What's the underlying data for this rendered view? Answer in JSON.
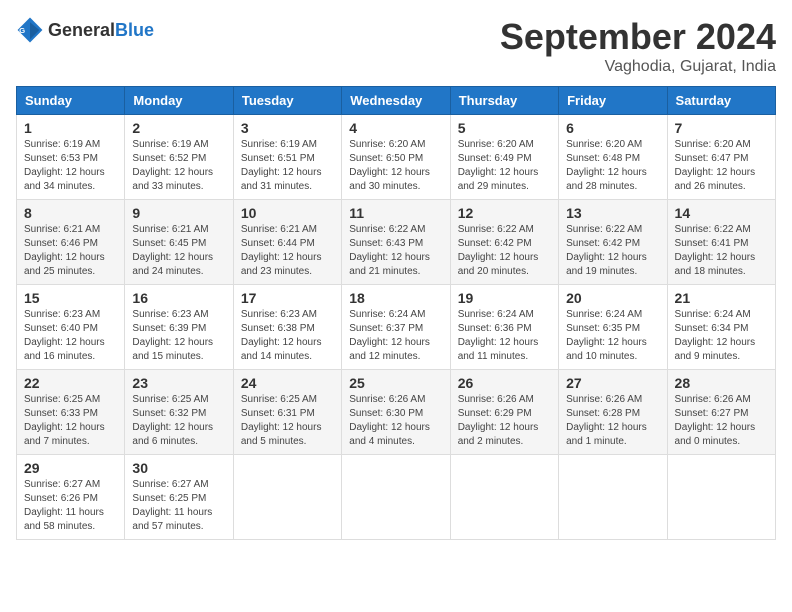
{
  "logo": {
    "general": "General",
    "blue": "Blue"
  },
  "title": "September 2024",
  "location": "Vaghodia, Gujarat, India",
  "headers": [
    "Sunday",
    "Monday",
    "Tuesday",
    "Wednesday",
    "Thursday",
    "Friday",
    "Saturday"
  ],
  "weeks": [
    [
      {
        "day": "1",
        "info": "Sunrise: 6:19 AM\nSunset: 6:53 PM\nDaylight: 12 hours\nand 34 minutes."
      },
      {
        "day": "2",
        "info": "Sunrise: 6:19 AM\nSunset: 6:52 PM\nDaylight: 12 hours\nand 33 minutes."
      },
      {
        "day": "3",
        "info": "Sunrise: 6:19 AM\nSunset: 6:51 PM\nDaylight: 12 hours\nand 31 minutes."
      },
      {
        "day": "4",
        "info": "Sunrise: 6:20 AM\nSunset: 6:50 PM\nDaylight: 12 hours\nand 30 minutes."
      },
      {
        "day": "5",
        "info": "Sunrise: 6:20 AM\nSunset: 6:49 PM\nDaylight: 12 hours\nand 29 minutes."
      },
      {
        "day": "6",
        "info": "Sunrise: 6:20 AM\nSunset: 6:48 PM\nDaylight: 12 hours\nand 28 minutes."
      },
      {
        "day": "7",
        "info": "Sunrise: 6:20 AM\nSunset: 6:47 PM\nDaylight: 12 hours\nand 26 minutes."
      }
    ],
    [
      {
        "day": "8",
        "info": "Sunrise: 6:21 AM\nSunset: 6:46 PM\nDaylight: 12 hours\nand 25 minutes."
      },
      {
        "day": "9",
        "info": "Sunrise: 6:21 AM\nSunset: 6:45 PM\nDaylight: 12 hours\nand 24 minutes."
      },
      {
        "day": "10",
        "info": "Sunrise: 6:21 AM\nSunset: 6:44 PM\nDaylight: 12 hours\nand 23 minutes."
      },
      {
        "day": "11",
        "info": "Sunrise: 6:22 AM\nSunset: 6:43 PM\nDaylight: 12 hours\nand 21 minutes."
      },
      {
        "day": "12",
        "info": "Sunrise: 6:22 AM\nSunset: 6:42 PM\nDaylight: 12 hours\nand 20 minutes."
      },
      {
        "day": "13",
        "info": "Sunrise: 6:22 AM\nSunset: 6:42 PM\nDaylight: 12 hours\nand 19 minutes."
      },
      {
        "day": "14",
        "info": "Sunrise: 6:22 AM\nSunset: 6:41 PM\nDaylight: 12 hours\nand 18 minutes."
      }
    ],
    [
      {
        "day": "15",
        "info": "Sunrise: 6:23 AM\nSunset: 6:40 PM\nDaylight: 12 hours\nand 16 minutes."
      },
      {
        "day": "16",
        "info": "Sunrise: 6:23 AM\nSunset: 6:39 PM\nDaylight: 12 hours\nand 15 minutes."
      },
      {
        "day": "17",
        "info": "Sunrise: 6:23 AM\nSunset: 6:38 PM\nDaylight: 12 hours\nand 14 minutes."
      },
      {
        "day": "18",
        "info": "Sunrise: 6:24 AM\nSunset: 6:37 PM\nDaylight: 12 hours\nand 12 minutes."
      },
      {
        "day": "19",
        "info": "Sunrise: 6:24 AM\nSunset: 6:36 PM\nDaylight: 12 hours\nand 11 minutes."
      },
      {
        "day": "20",
        "info": "Sunrise: 6:24 AM\nSunset: 6:35 PM\nDaylight: 12 hours\nand 10 minutes."
      },
      {
        "day": "21",
        "info": "Sunrise: 6:24 AM\nSunset: 6:34 PM\nDaylight: 12 hours\nand 9 minutes."
      }
    ],
    [
      {
        "day": "22",
        "info": "Sunrise: 6:25 AM\nSunset: 6:33 PM\nDaylight: 12 hours\nand 7 minutes."
      },
      {
        "day": "23",
        "info": "Sunrise: 6:25 AM\nSunset: 6:32 PM\nDaylight: 12 hours\nand 6 minutes."
      },
      {
        "day": "24",
        "info": "Sunrise: 6:25 AM\nSunset: 6:31 PM\nDaylight: 12 hours\nand 5 minutes."
      },
      {
        "day": "25",
        "info": "Sunrise: 6:26 AM\nSunset: 6:30 PM\nDaylight: 12 hours\nand 4 minutes."
      },
      {
        "day": "26",
        "info": "Sunrise: 6:26 AM\nSunset: 6:29 PM\nDaylight: 12 hours\nand 2 minutes."
      },
      {
        "day": "27",
        "info": "Sunrise: 6:26 AM\nSunset: 6:28 PM\nDaylight: 12 hours\nand 1 minute."
      },
      {
        "day": "28",
        "info": "Sunrise: 6:26 AM\nSunset: 6:27 PM\nDaylight: 12 hours\nand 0 minutes."
      }
    ],
    [
      {
        "day": "29",
        "info": "Sunrise: 6:27 AM\nSunset: 6:26 PM\nDaylight: 11 hours\nand 58 minutes."
      },
      {
        "day": "30",
        "info": "Sunrise: 6:27 AM\nSunset: 6:25 PM\nDaylight: 11 hours\nand 57 minutes."
      },
      {
        "day": "",
        "info": ""
      },
      {
        "day": "",
        "info": ""
      },
      {
        "day": "",
        "info": ""
      },
      {
        "day": "",
        "info": ""
      },
      {
        "day": "",
        "info": ""
      }
    ]
  ]
}
